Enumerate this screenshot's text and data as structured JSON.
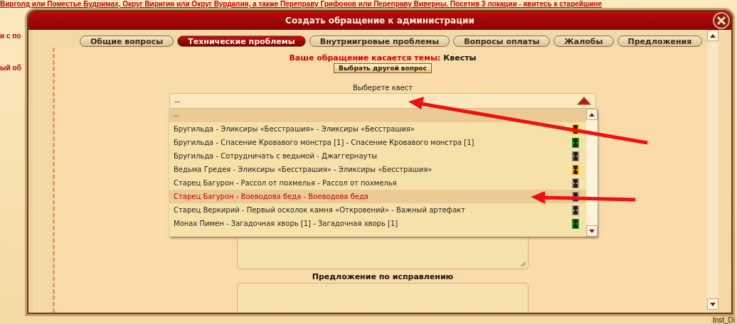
{
  "page": {
    "headline": "Вирголд или Поместье Будримах, Округ Виригия или Округ Вурдалия, а также Переправу Грифонов или Переправу Виверны. Посетив 3 локации - явитесь к старейшине",
    "fragments": [
      "и с по",
      "ый об"
    ],
    "corner_label": "Inst_Di"
  },
  "dialog": {
    "title": "Создать обращение к администрации"
  },
  "tabs": [
    {
      "label": "Общие вопросы",
      "selected": false
    },
    {
      "label": "Технические проблемы",
      "selected": true
    },
    {
      "label": "Внутриигровые проблемы",
      "selected": false
    },
    {
      "label": "Вопросы оплаты",
      "selected": false
    },
    {
      "label": "Жалобы",
      "selected": false
    },
    {
      "label": "Предложения",
      "selected": false
    }
  ],
  "topic": {
    "label": "Ваше обращение касается темы:",
    "value": "Квесты",
    "change_button": "Выбрать другой вопрос"
  },
  "quest_select": {
    "label": "Выберете квест",
    "value": "--",
    "expanded": true,
    "options": [
      {
        "text": "--",
        "selected": true
      },
      {
        "text": "Бругильда - Эликсиры «Бесстрашия» - Эликсиры «Бесстрашия»",
        "selected": false,
        "color": "#f5c400"
      },
      {
        "text": "Бругильда - Спасение Кровавого монстра [1] - Спасение Кровавого монстра [1]",
        "selected": false,
        "color": "#1e9a1e"
      },
      {
        "text": "Бругильда - Сотрудничать с ведьмой - Джаггернауты",
        "selected": false,
        "color": "#8a8a8a"
      },
      {
        "text": "Ведьма Гредея - Эликсиры «Бесстрашия» - Эликсиры «Бесстрашия»",
        "selected": false,
        "color": "#f5c400"
      },
      {
        "text": "Старец Багурон - Рассол от похмелья - Рассол от похмелья",
        "selected": false,
        "color": "#a09a8a"
      },
      {
        "text": "Старец Багурон - Воеводова беда - Воеводова беда",
        "selected": true,
        "color": "#a09a8a"
      },
      {
        "text": "Старец Веркирий - Первый осколок камня «Откровений» - Важный артефакт",
        "selected": false,
        "color": "#a09a8a"
      },
      {
        "text": "Монах Пимен - Загадочная хворь [1] - Загадочная хворь [1]",
        "selected": false,
        "color": "#1e9a1e"
      }
    ]
  },
  "fix_label": "Предложение по исправлению"
}
